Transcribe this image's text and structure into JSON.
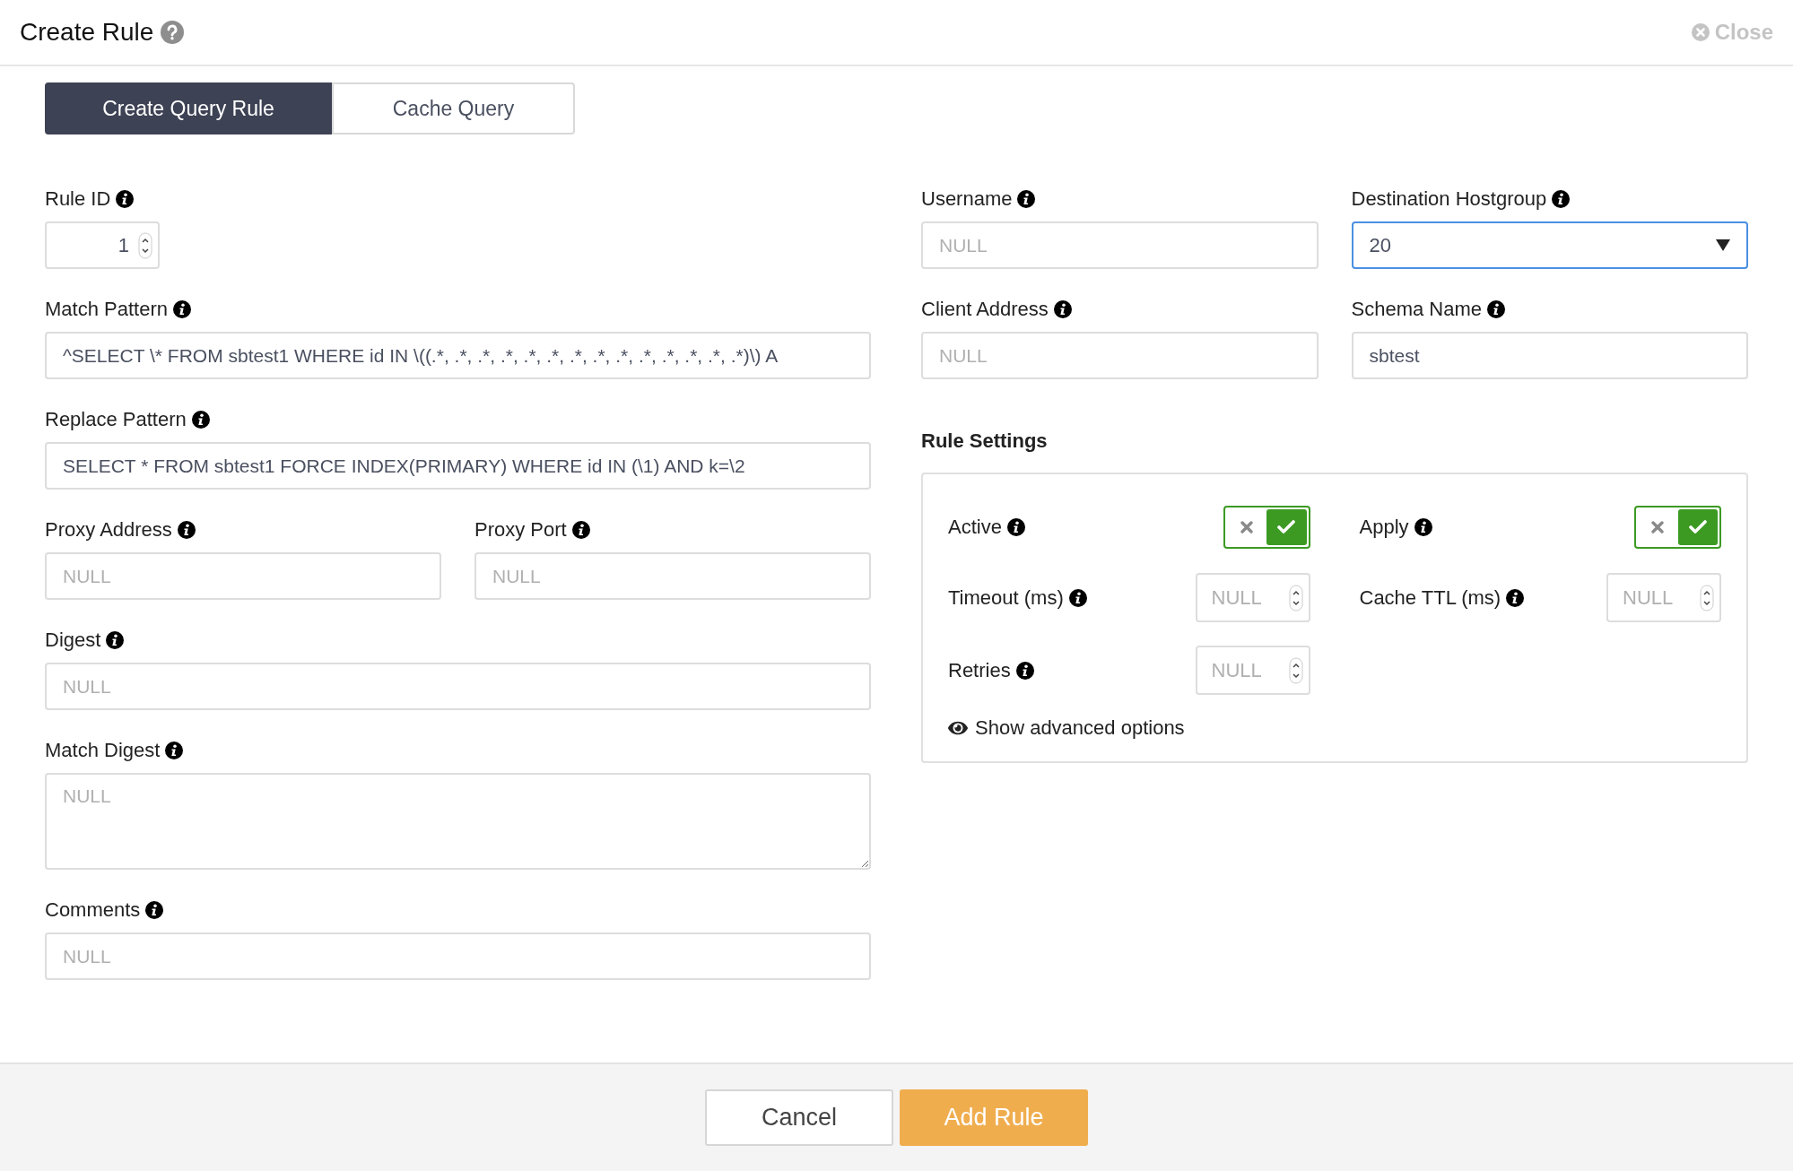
{
  "header": {
    "title": "Create Rule",
    "close": "Close"
  },
  "tabs": [
    {
      "label": "Create Query Rule",
      "selected": true
    },
    {
      "label": "Cache Query",
      "selected": false
    }
  ],
  "left_fields": [
    {
      "kind": "number",
      "label": "Rule ID",
      "value": "1"
    },
    {
      "kind": "text",
      "label": "Match Pattern",
      "value": "^SELECT \\* FROM sbtest1 WHERE id IN \\((.*, .*, .*, .*, .*, .*, .*, .*, .*, .*, .*, .*, .*, .*)\\) A"
    },
    {
      "kind": "text",
      "label": "Replace Pattern",
      "value": "SELECT * FROM sbtest1 FORCE INDEX(PRIMARY) WHERE id IN (\\1) AND k=\\2"
    },
    {
      "kind": "pair",
      "fields": [
        {
          "label": "Proxy Address",
          "placeholder": "NULL"
        },
        {
          "label": "Proxy Port",
          "placeholder": "NULL"
        }
      ]
    },
    {
      "kind": "text",
      "label": "Digest",
      "placeholder": "NULL"
    },
    {
      "kind": "textarea",
      "label": "Match Digest",
      "placeholder": "NULL"
    },
    {
      "kind": "text",
      "label": "Comments",
      "placeholder": "NULL"
    }
  ],
  "right_fields": [
    {
      "kind": "text",
      "label": "Username",
      "placeholder": "NULL"
    },
    {
      "kind": "select",
      "label": "Destination Hostgroup",
      "value": "20"
    },
    {
      "kind": "text",
      "label": "Client Address",
      "placeholder": "NULL"
    },
    {
      "kind": "text",
      "label": "Schema Name",
      "value": "sbtest"
    }
  ],
  "rule_settings": {
    "title": "Rule Settings",
    "items": [
      {
        "kind": "toggle",
        "label": "Active",
        "on": true
      },
      {
        "kind": "toggle",
        "label": "Apply",
        "on": true
      },
      {
        "kind": "number",
        "label": "Timeout (ms)",
        "placeholder": "NULL"
      },
      {
        "kind": "number",
        "label": "Cache TTL (ms)",
        "placeholder": "NULL"
      },
      {
        "kind": "number",
        "label": "Retries",
        "placeholder": "NULL"
      }
    ],
    "advanced_link": "Show advanced options"
  },
  "footer": {
    "buttons": [
      {
        "kind": "secondary",
        "label": "Cancel"
      },
      {
        "kind": "primary",
        "label": "Add Rule"
      }
    ]
  }
}
